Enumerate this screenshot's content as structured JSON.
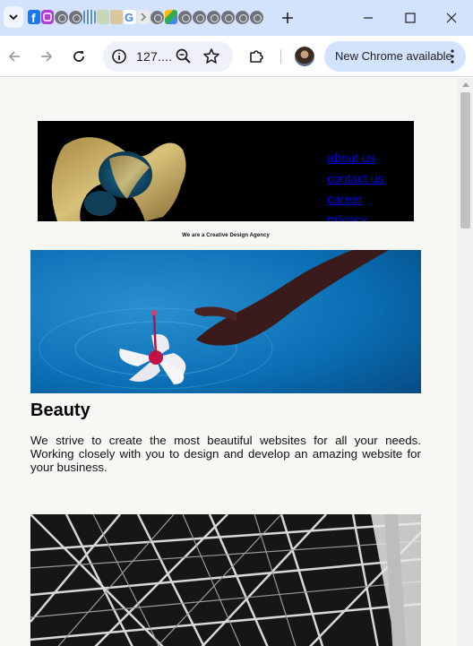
{
  "browser": {
    "tab_favicons": [
      "facebook-icon",
      "instagram-icon",
      "site-icon",
      "site-icon",
      "grid-icon",
      "image-icon",
      "image-icon",
      "google-icon",
      "chevron-icon",
      "site-icon",
      "google-drive-icon",
      "site-icon",
      "site-icon",
      "site-icon",
      "site-icon",
      "site-icon",
      "site-icon"
    ],
    "url": "127....",
    "update_label": "New Chrome available"
  },
  "page": {
    "nav": [
      "about us",
      "contact us",
      "career",
      "privacy"
    ],
    "tagline": "We are a Creative Design Agency",
    "section": {
      "title": "Beauty",
      "text": "We strive to create the most beautiful websites for all your needs. Working closely with you to design and develop an amazing website for your business."
    }
  },
  "colors": {
    "tabstrip": "#d3e3fd",
    "page_bg": "#f8f7f3",
    "link": "#0000ee",
    "water": "#0a6fb5"
  }
}
